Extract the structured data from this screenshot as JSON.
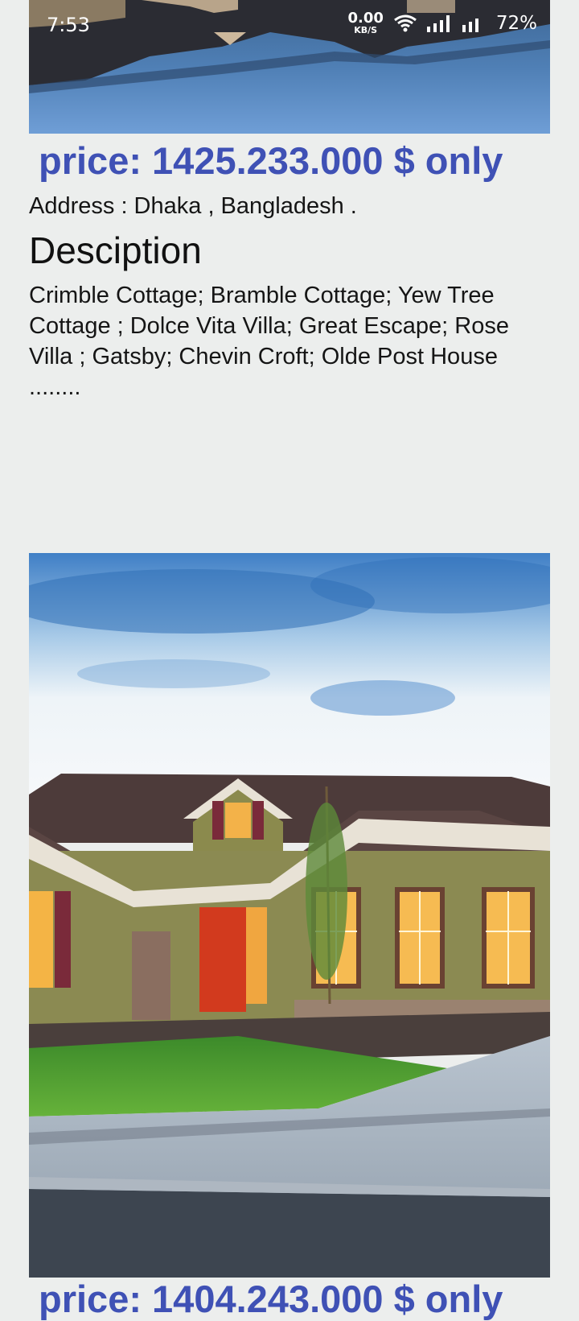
{
  "status_bar": {
    "time": "7:53",
    "net_speed_value": "0.00",
    "net_speed_unit": "KB/S",
    "battery": "72%",
    "icons": [
      "wifi-icon",
      "signal-icon",
      "signal-icon"
    ]
  },
  "listings": [
    {
      "image": "house-photo-reflection",
      "price": "price: 1425.233.000 $ only",
      "address": "Address : Dhaka , Bangladesh .",
      "description_heading": "Desciption",
      "description": "Crimble Cottage; Bramble Cottage; Yew Tree Cottage ; Dolce Vita Villa; Great Escape; Rose Villa ; Gatsby; Chevin Croft; Olde Post House ........"
    },
    {
      "image": "house-photo-green-lawn",
      "price": "price: 1404.243.000 $ only"
    }
  ],
  "colors": {
    "background": "#eceeed",
    "price_text": "#3f51b5"
  }
}
